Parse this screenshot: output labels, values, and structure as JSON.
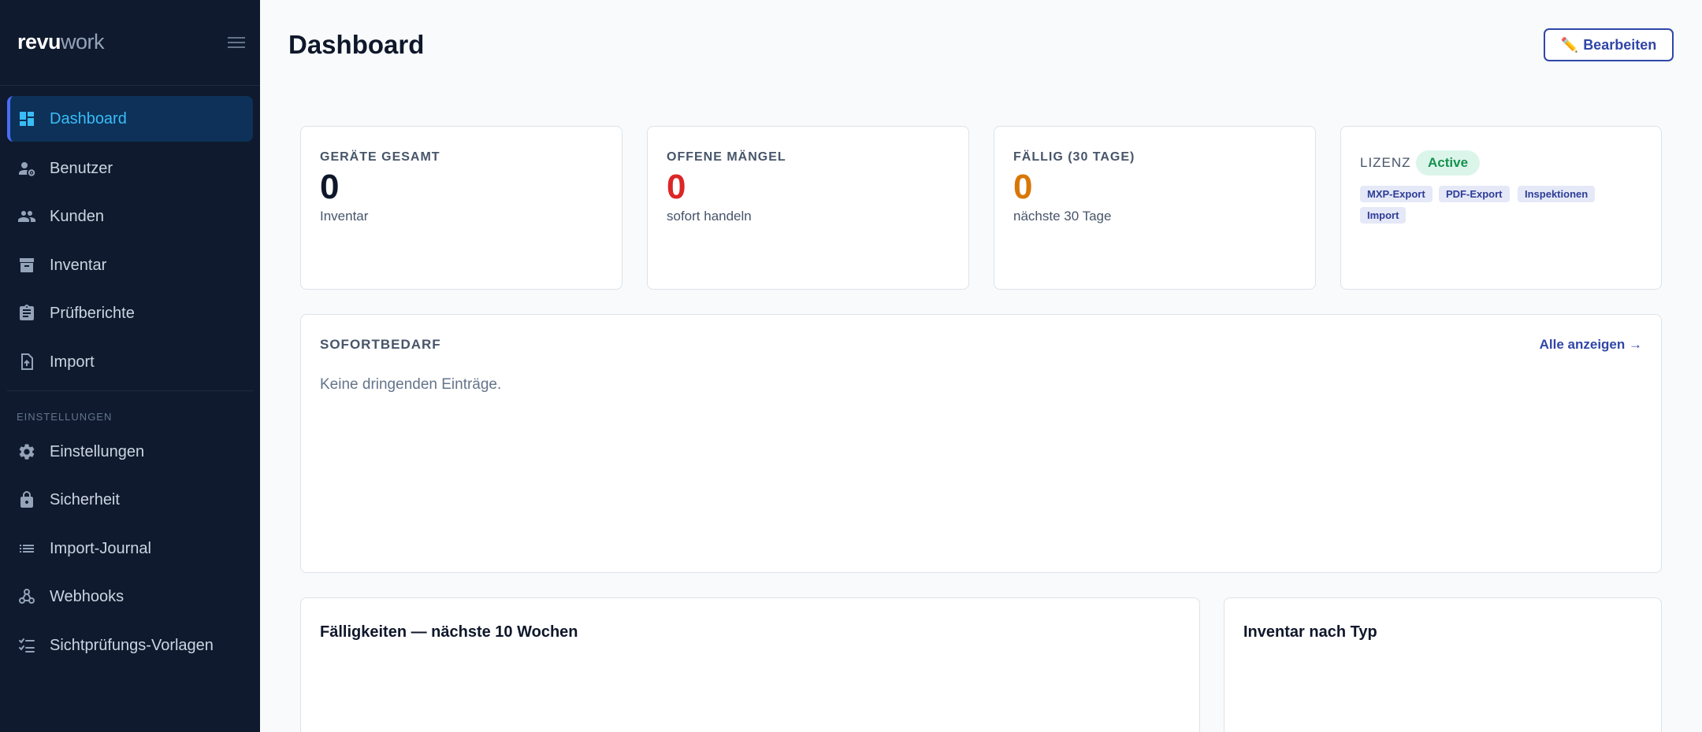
{
  "brand": {
    "part1": "revu",
    "part2": "work"
  },
  "sidebar": {
    "items": [
      {
        "label": "Dashboard",
        "icon": "dashboard-icon",
        "active": true
      },
      {
        "label": "Benutzer",
        "icon": "user-gear-icon"
      },
      {
        "label": "Kunden",
        "icon": "people-icon"
      },
      {
        "label": "Inventar",
        "icon": "archive-icon"
      },
      {
        "label": "Prüfberichte",
        "icon": "clipboard-icon"
      },
      {
        "label": "Import",
        "icon": "file-upload-icon"
      }
    ],
    "section_label": "EINSTELLUNGEN",
    "settings_items": [
      {
        "label": "Einstellungen",
        "icon": "gear-icon"
      },
      {
        "label": "Sicherheit",
        "icon": "lock-icon"
      },
      {
        "label": "Import-Journal",
        "icon": "list-icon"
      },
      {
        "label": "Webhooks",
        "icon": "webhook-icon"
      },
      {
        "label": "Sichtprüfungs-Vorlagen",
        "icon": "checklist-icon"
      }
    ]
  },
  "header": {
    "title": "Dashboard",
    "edit_icon": "✏️",
    "edit_label": "Bearbeiten"
  },
  "stats": [
    {
      "label": "GERÄTE GESAMT",
      "value": "0",
      "sub": "Inventar",
      "color": "#0f172a"
    },
    {
      "label": "OFFENE MÄNGEL",
      "value": "0",
      "sub": "sofort handeln",
      "color": "#dc2626"
    },
    {
      "label": "FÄLLIG (30 TAGE)",
      "value": "0",
      "sub": "nächste 30 Tage",
      "color": "#d97706"
    }
  ],
  "license": {
    "label": "LIZENZ",
    "status": "Active",
    "features": [
      "MXP-Export",
      "PDF-Export",
      "Inspektionen",
      "Import"
    ]
  },
  "urgent": {
    "label": "SOFORTBEDARF",
    "show_all": "Alle anzeigen →",
    "empty": "Keine dringenden Einträge."
  },
  "panels": {
    "due_title": "Fälligkeiten — nächste 10 Wochen",
    "inventory_title": "Inventar nach Typ"
  },
  "colors": {
    "sidebar_bg": "#0f1a2e",
    "accent": "#3046a8",
    "active_text": "#38bdf8"
  }
}
